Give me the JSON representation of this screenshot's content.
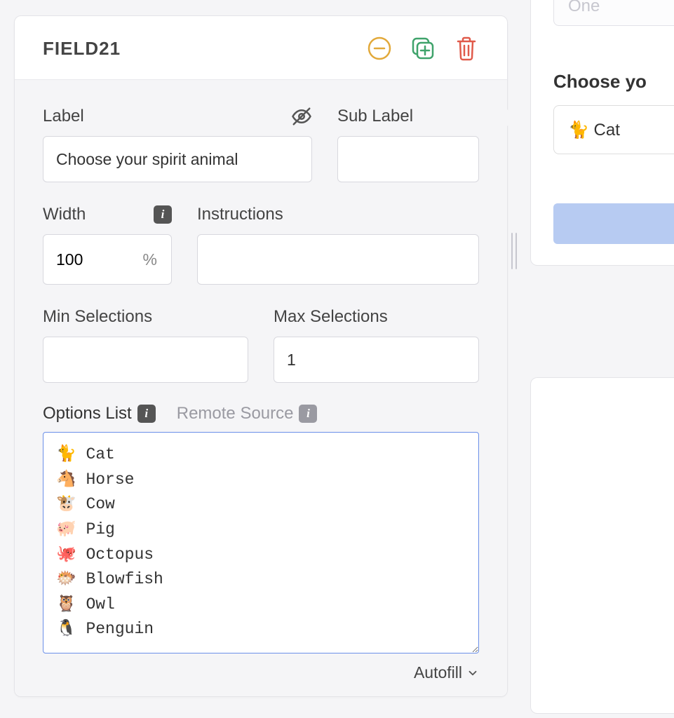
{
  "header": {
    "title": "FIELD21"
  },
  "labels": {
    "label": "Label",
    "sub_label": "Sub Label",
    "width": "Width",
    "instructions": "Instructions",
    "min_selections": "Min Selections",
    "max_selections": "Max Selections",
    "options_list": "Options List",
    "remote_source": "Remote Source",
    "autofill": "Autofill"
  },
  "values": {
    "label": "Choose your spirit animal",
    "sub_label": "",
    "width": "100",
    "width_unit": "%",
    "instructions": "",
    "min_selections": "",
    "max_selections": "1",
    "options_text": "🐈 Cat\n🐴 Horse\n🐮 Cow\n🐖 Pig\n🐙 Octopus\n🐡 Blowfish\n🦉 Owl\n🐧 Penguin"
  },
  "preview": {
    "disabled_option": "One",
    "label": "Choose yo",
    "selected": "🐈 Cat"
  }
}
